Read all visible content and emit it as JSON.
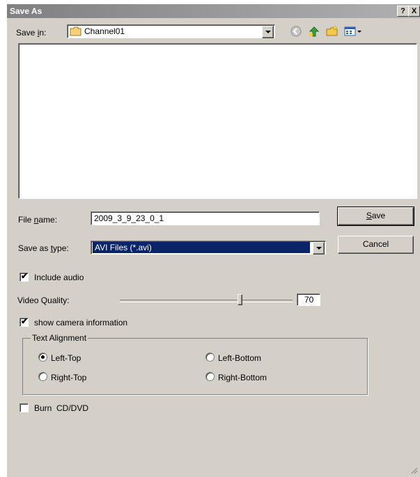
{
  "window": {
    "title": "Save As",
    "help_label": "?",
    "close_label": "X"
  },
  "save_in": {
    "label": "Save in:",
    "value": "Channel01"
  },
  "file_name": {
    "label": "File name:",
    "value": "2009_3_9_23_0_1"
  },
  "save_as_type": {
    "label": "Save as type:",
    "value": "AVI Files (*.avi)"
  },
  "buttons": {
    "save": "Save",
    "cancel": "Cancel"
  },
  "include_audio": {
    "label": "Include audio",
    "checked": true
  },
  "video_quality": {
    "label": "Video Quality:",
    "value": "70",
    "level": 70
  },
  "show_camera": {
    "label": "show camera information",
    "checked": true
  },
  "text_alignment": {
    "legend": "Text Alignment",
    "options": [
      {
        "label": "Left-Top",
        "selected": true
      },
      {
        "label": "Left-Bottom",
        "selected": false
      },
      {
        "label": "Right-Top",
        "selected": false
      },
      {
        "label": "Right-Bottom",
        "selected": false
      }
    ]
  },
  "burn": {
    "label": "Burn  CD/DVD",
    "checked": false
  },
  "icons": [
    "folder-icon",
    "back-icon",
    "up-folder-icon",
    "new-folder-icon",
    "view-menu-icon",
    "dropdown-arrow-icon"
  ]
}
